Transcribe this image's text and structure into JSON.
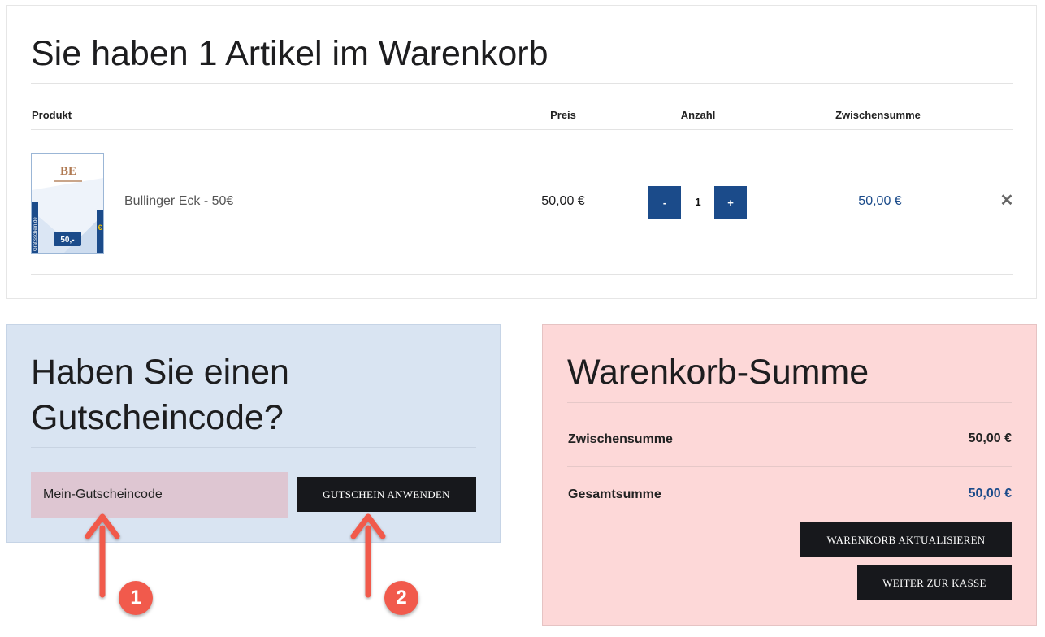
{
  "cart": {
    "title": "Sie haben 1 Artikel im Warenkorb",
    "columns": {
      "product": "Produkt",
      "price": "Preis",
      "quantity": "Anzahl",
      "subtotal": "Zwischensumme"
    },
    "items": [
      {
        "name": "Bullinger Eck - 50€",
        "price": "50,00 €",
        "quantity": "1",
        "subtotal": "50,00 €",
        "thumb": {
          "logo_text": "BE",
          "badge_text": "50,-",
          "side_text": "Gratisschein.de",
          "euro_symbol": "€"
        }
      }
    ],
    "qty_minus": "-",
    "qty_plus": "+",
    "remove_symbol": "✕"
  },
  "coupon": {
    "title": "Haben Sie einen Gutscheincode?",
    "input_value": "Mein-Gutscheincode",
    "apply_label": "GUTSCHEIN ANWENDEN"
  },
  "totals": {
    "title": "Warenkorb-Summe",
    "subtotal_label": "Zwischensumme",
    "subtotal_value": "50,00 €",
    "total_label": "Gesamtsumme",
    "total_value": "50,00 €",
    "update_label": "WARENKORB AKTUALISIEREN",
    "checkout_label": "WEITER ZUR KASSE"
  },
  "annotations": {
    "badge_1": "1",
    "badge_2": "2"
  },
  "colors": {
    "accent_blue": "#1b4b8a",
    "coupon_bg": "#d9e4f2",
    "totals_bg": "#fdd8d8",
    "input_bg": "#dec6d2",
    "button_dark": "#17181c",
    "annotation_red": "#f15a4c"
  }
}
